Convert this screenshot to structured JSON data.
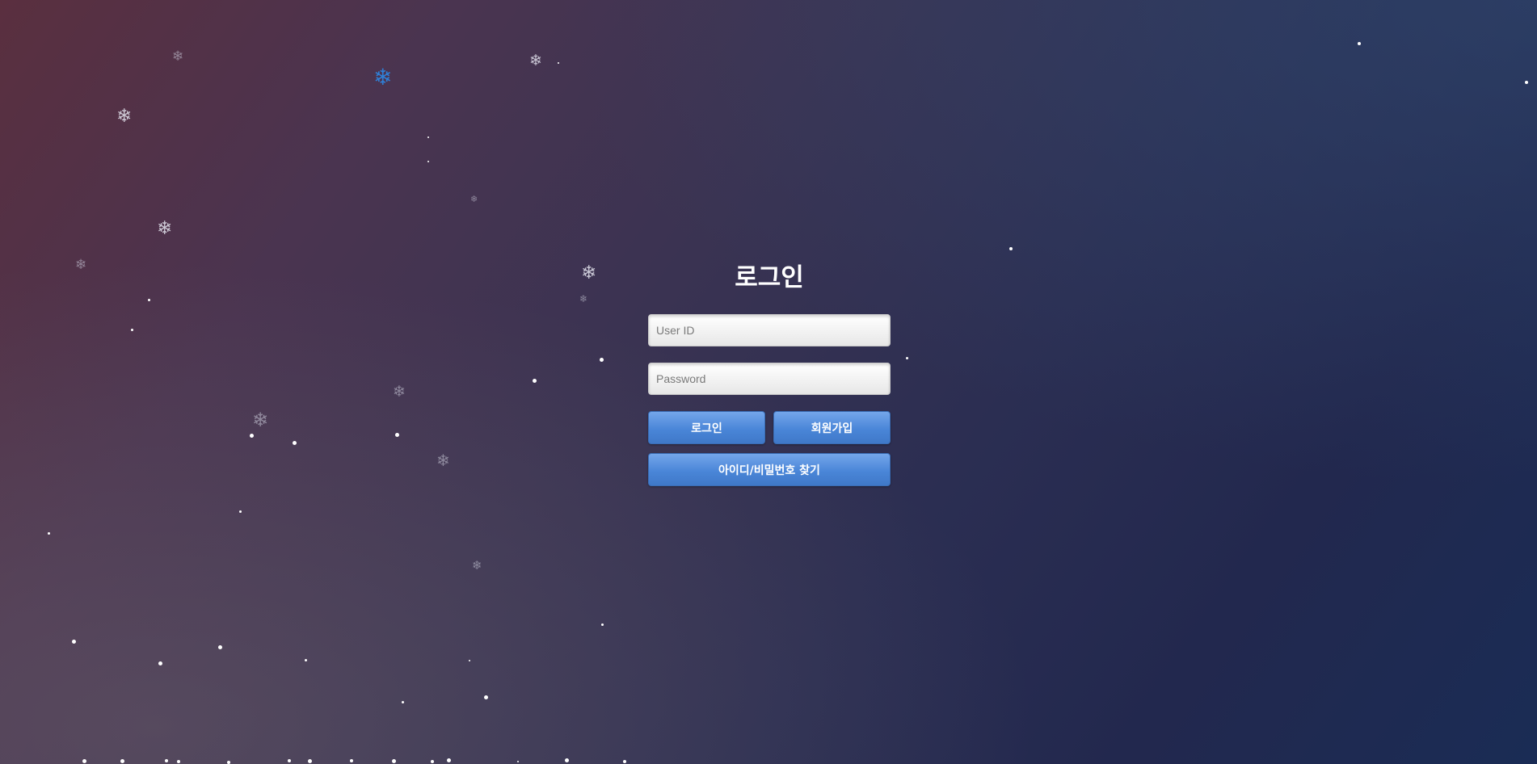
{
  "login": {
    "title": "로그인",
    "user_id_placeholder": "User ID",
    "password_placeholder": "Password",
    "login_button": "로그인",
    "signup_button": "회원가입",
    "find_account_button": "아이디/비밀번호 찾기"
  },
  "background": {
    "gradient_colors": [
      "#5a2f3f",
      "#3a3352",
      "#22284e",
      "#1a2c55"
    ],
    "effect": "falling-snow",
    "snowflake_icon": "❄"
  },
  "colors": {
    "button": "#4a86d8",
    "accent_flake": "#2f7fd6",
    "title": "#ffffff"
  }
}
